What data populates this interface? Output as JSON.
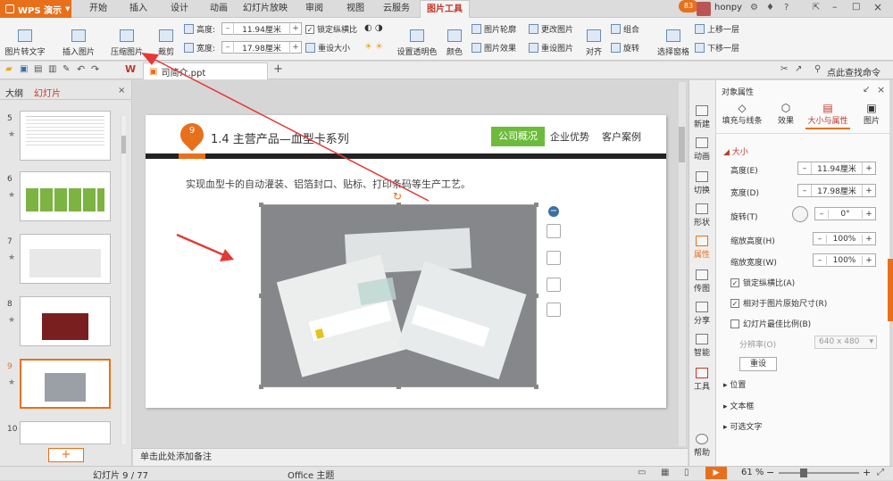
{
  "app": {
    "name": "WPS 演示"
  },
  "menu_tabs": [
    "开始",
    "插入",
    "设计",
    "动画",
    "幻灯片放映",
    "审阅",
    "视图",
    "云服务",
    "图片工具"
  ],
  "active_tab": "图片工具",
  "titlebar": {
    "badge": "83",
    "user": "honpy"
  },
  "ribbon": {
    "img_to_text": "图片转文字",
    "insert_img": "插入图片",
    "compress": "压缩图片",
    "crop": "裁剪",
    "height_label": "高度:",
    "height_value": "11.94厘米",
    "width_label": "宽度:",
    "width_value": "17.98厘米",
    "lock_ratio": "锁定纵横比",
    "reset_size": "重设大小",
    "set_transparent": "设置透明色",
    "color": "颜色",
    "outline": "图片轮廓",
    "effects": "图片效果",
    "change_pic": "更改图片",
    "reset_pic": "重设图片",
    "align": "对齐",
    "group": "组合",
    "rotate": "旋转",
    "selection_pane": "选择窗格",
    "bring_forward": "上移一层",
    "send_backward": "下移一层"
  },
  "quickbar": {
    "file_tab": "简介.ppt",
    "file_tab_full": "司简介.ppt",
    "search": "点此查找命令"
  },
  "left_panel": {
    "tab_outline": "大纲",
    "tab_slides": "幻灯片",
    "thumb_numbers": [
      "5",
      "6",
      "7",
      "8",
      "9",
      "10"
    ],
    "selected": "9",
    "add": "+"
  },
  "slide": {
    "badge": "9",
    "title": "1.4  主营产品—血型卡系列",
    "nav": [
      "公司概况",
      "企业优势",
      "客户案例"
    ],
    "nav_active": "公司概况",
    "body_text": "实现血型卡的自动灌装、铝箔封口、贴标、打印条码等生产工艺。"
  },
  "notes_placeholder": "单击此处添加备注",
  "status": {
    "slide_count": "幻灯片 9 / 77",
    "theme": "Office 主题",
    "zoom": "61 %"
  },
  "vtabs": [
    "新建",
    "动画",
    "切换",
    "形状",
    "属性",
    "传图",
    "分享",
    "智能",
    "工具",
    "帮助"
  ],
  "props": {
    "header": "对象属性",
    "tabs": [
      "填充与线条",
      "效果",
      "大小与属性",
      "图片"
    ],
    "active_tab": "大小与属性",
    "section_size": "大小",
    "height_label": "高度(E)",
    "height_value": "11.94厘米",
    "width_label": "宽度(D)",
    "width_value": "17.98厘米",
    "rotate_label": "旋转(T)",
    "rotate_value": "0°",
    "scale_h_label": "缩放高度(H)",
    "scale_h_value": "100%",
    "scale_w_label": "缩放宽度(W)",
    "scale_w_value": "100%",
    "lock_ratio": "锁定纵横比(A)",
    "relative_orig": "相对于图片原始尺寸(R)",
    "best_scale": "幻灯片最佳比例(B)",
    "resolution_label": "分辨率(O)",
    "resolution_value": "640 x 480",
    "reset_btn": "重设",
    "section_position": "位置",
    "section_textbox": "文本框",
    "section_alt": "可选文字"
  },
  "colors": {
    "accent": "#e8701a",
    "green": "#6dbb3c",
    "dark": "#222222"
  }
}
